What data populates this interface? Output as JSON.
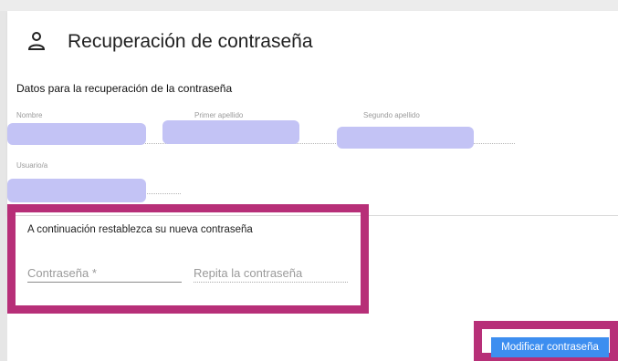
{
  "title": "Recuperación de contraseña",
  "title_icon": "person-icon",
  "recovery": {
    "heading": "Datos para la recuperación de la contraseña",
    "labels": {
      "nombre": "Nombre",
      "primer_apellido": "Primer apellido",
      "segundo_apellido": "Segundo apellido",
      "usuario": "Usuario/a"
    },
    "usuario_value_redacted": "••••••••"
  },
  "new_password": {
    "instruction": "A continuación restablezca su nueva contraseña",
    "password_placeholder": "Contraseña *",
    "repeat_placeholder": "Repita la contraseña"
  },
  "actions": {
    "modify_label": "Modificar contraseña"
  },
  "colors": {
    "highlight": "#b72f78",
    "button": "#3d8ef0",
    "redaction": "#c3c3f5"
  }
}
